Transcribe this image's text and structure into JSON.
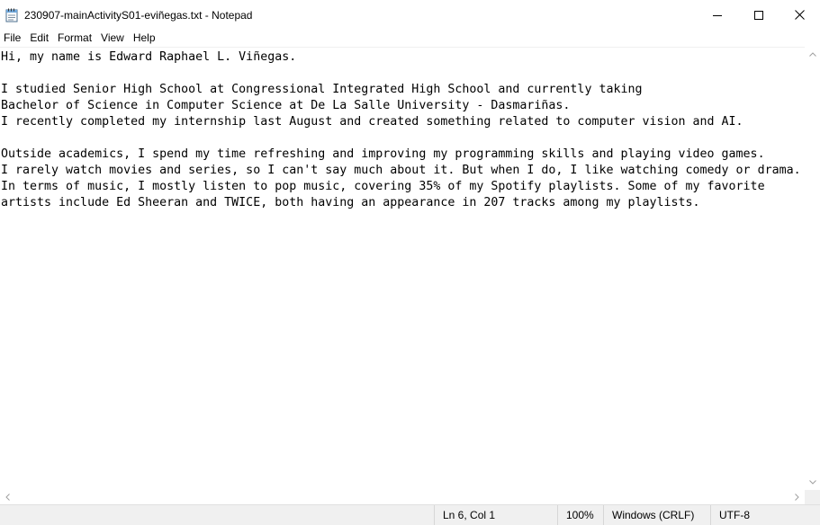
{
  "window": {
    "title": "230907-mainActivityS01-eviñegas.txt - Notepad",
    "app_icon": "notepad-icon",
    "controls": {
      "minimize_icon": "minimize-icon",
      "maximize_icon": "maximize-icon",
      "close_icon": "close-icon"
    }
  },
  "menu": {
    "items": [
      "File",
      "Edit",
      "Format",
      "View",
      "Help"
    ]
  },
  "editor": {
    "content": "Hi, my name is Edward Raphael L. Viñegas.\n\nI studied Senior High School at Congressional Integrated High School and currently taking\nBachelor of Science in Computer Science at De La Salle University - Dasmariñas.\nI recently completed my internship last August and created something related to computer vision and AI.\n\nOutside academics, I spend my time refreshing and improving my programming skills and playing video games.\nI rarely watch movies and series, so I can't say much about it. But when I do, I like watching comedy or drama.\nIn terms of music, I mostly listen to pop music, covering 35% of my Spotify playlists. Some of my favorite\nartists include Ed Sheeran and TWICE, both having an appearance in 207 tracks among my playlists."
  },
  "status": {
    "position": "Ln 6, Col 1",
    "zoom": "100%",
    "line_ending": "Windows (CRLF)",
    "encoding": "UTF-8"
  },
  "colors": {
    "statusbar_bg": "#f0f0f0",
    "text": "#000000",
    "background": "#ffffff"
  }
}
